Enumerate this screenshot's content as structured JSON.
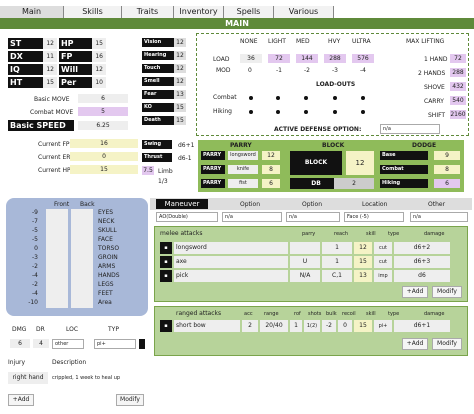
{
  "tabs": [
    "Main",
    "Skills",
    "Traits",
    "Inventory",
    "Spells",
    "Various"
  ],
  "title": "MAIN",
  "attrs": [
    {
      "k": "ST",
      "v": "12",
      "k2": "HP",
      "v2": "15"
    },
    {
      "k": "DX",
      "v": "11",
      "k2": "FP",
      "v2": "16"
    },
    {
      "k": "IQ",
      "v": "12",
      "k2": "Will",
      "v2": "12"
    },
    {
      "k": "HT",
      "v": "15",
      "k2": "Per",
      "v2": "10"
    }
  ],
  "senses": [
    {
      "k": "Vision",
      "v": "12"
    },
    {
      "k": "Hearing",
      "v": "12"
    },
    {
      "k": "Touch",
      "v": "12"
    },
    {
      "k": "Smell",
      "v": "12"
    },
    {
      "k": "Fear",
      "v": "13"
    },
    {
      "k": "KO",
      "v": "15"
    },
    {
      "k": "Death",
      "v": "15"
    }
  ],
  "move": {
    "basic_label": "Basic MOVE",
    "basic": "6",
    "combat_label": "Combat MOVE",
    "combat": "5",
    "speed_label": "Basic SPEED",
    "speed": "6.25"
  },
  "current": [
    {
      "k": "Current FP",
      "v": "16"
    },
    {
      "k": "Current ER",
      "v": "0"
    },
    {
      "k": "Current HP",
      "v": "15"
    }
  ],
  "damage": {
    "swing_label": "Swing",
    "swing": "d6+1",
    "thrust_label": "Thrust",
    "thrust": "d6-1",
    "limb_val": "7.5",
    "limb_label": "Limb",
    "frac": "1/3"
  },
  "encumbrance": {
    "headers": [
      "NONE",
      "LIGHT",
      "MED",
      "HVY",
      "ULTRA"
    ],
    "load_label": "LOAD",
    "load": [
      "36",
      "72",
      "144",
      "288",
      "576"
    ],
    "mod_label": "MOD",
    "mod": [
      "0",
      "-1",
      "-2",
      "-3",
      "-4"
    ],
    "loadouts_label": "LOAD-OUTS",
    "combat_label": "Combat",
    "hiking_label": "Hiking"
  },
  "lifting": {
    "header": "MAX LIFTING",
    "rows": [
      {
        "k": "1 HAND",
        "v": "72"
      },
      {
        "k": "2 HANDS",
        "v": "288"
      },
      {
        "k": "SHOVE",
        "v": "432"
      },
      {
        "k": "CARRY",
        "v": "540"
      },
      {
        "k": "SHIFT",
        "v": "2160"
      }
    ]
  },
  "active_defense": {
    "label": "ACTIVE DEFENSE OPTION:",
    "value": "n/a"
  },
  "defense": {
    "parry_header": "PARRY",
    "block_header": "BLOCK",
    "dodge_header": "DODGE",
    "parry": [
      {
        "k": "PARRY",
        "w": "longsword",
        "v": "12"
      },
      {
        "k": "PARRY",
        "w": "knife",
        "v": "8"
      },
      {
        "k": "PARRY",
        "w": "fist",
        "v": "6"
      }
    ],
    "block_label": "BLOCK",
    "block": "12",
    "db_label": "DB",
    "db": "2",
    "dodge": [
      {
        "k": "Base",
        "v": "9"
      },
      {
        "k": "Combat",
        "v": "8"
      },
      {
        "k": "Hiking",
        "v": "6"
      }
    ]
  },
  "hit_locations": {
    "front_label": "Front",
    "back_label": "Back",
    "rows": [
      {
        "r": "-9",
        "n": "EYES"
      },
      {
        "r": "-7",
        "n": "NECK"
      },
      {
        "r": "-5",
        "n": "SKULL"
      },
      {
        "r": "-5",
        "n": "FACE"
      },
      {
        "r": "0",
        "n": "TORSO"
      },
      {
        "r": "-3",
        "n": "GROIN"
      },
      {
        "r": "-2",
        "n": "ARMS"
      },
      {
        "r": "-4",
        "n": "HANDS"
      },
      {
        "r": "-2",
        "n": "LEGS"
      },
      {
        "r": "-4",
        "n": "FEET"
      },
      {
        "r": "-10",
        "n": "Area"
      }
    ]
  },
  "injury_bar": {
    "dmg_label": "DMG",
    "dr_label": "DR",
    "loc_label": "LOC",
    "typ_label": "TYP",
    "dmg": "6",
    "dr": "4",
    "loc": "other",
    "typ": "pi+"
  },
  "injury": {
    "label": "Injury",
    "desc_label": "Description",
    "name": "right hand",
    "desc": "crippled, 1 week to heal up",
    "add": "+Add",
    "modify": "Modify"
  },
  "maneuver": {
    "label": "Maneuver",
    "option1_label": "Option",
    "option2_label": "Option",
    "location_label": "Location",
    "other_label": "Other",
    "value": "AO(Double)",
    "option1": "n/a",
    "option2": "n/a",
    "location": "Face (-5)",
    "other": "n/a"
  },
  "melee": {
    "header": "melee attacks",
    "cols": [
      "parry",
      "reach",
      "skill",
      "type",
      "damage"
    ],
    "rows": [
      {
        "name": "longsword",
        "parry": "",
        "reach": "1",
        "skill": "12",
        "type": "cut",
        "damage": "d6+2"
      },
      {
        "name": "axe",
        "parry": "U",
        "reach": "1",
        "skill": "15",
        "type": "cut",
        "damage": "d6+3"
      },
      {
        "name": "pick",
        "parry": "N/A",
        "reach": "C,1",
        "skill": "13",
        "type": "imp",
        "damage": "d6"
      }
    ],
    "add": "+Add",
    "modify": "Modify"
  },
  "ranged": {
    "header": "ranged attacks",
    "cols": [
      "acc",
      "range",
      "rof",
      "shots",
      "bulk",
      "recoil",
      "skill",
      "type",
      "damage"
    ],
    "rows": [
      {
        "name": "short bow",
        "acc": "2",
        "range": "20/40",
        "rof": "1",
        "shots": "1(2)",
        "bulk": "-2",
        "recoil": "0",
        "skill": "15",
        "type": "pi+",
        "damage": "d6+1"
      }
    ],
    "add": "+Add",
    "modify": "Modify"
  }
}
